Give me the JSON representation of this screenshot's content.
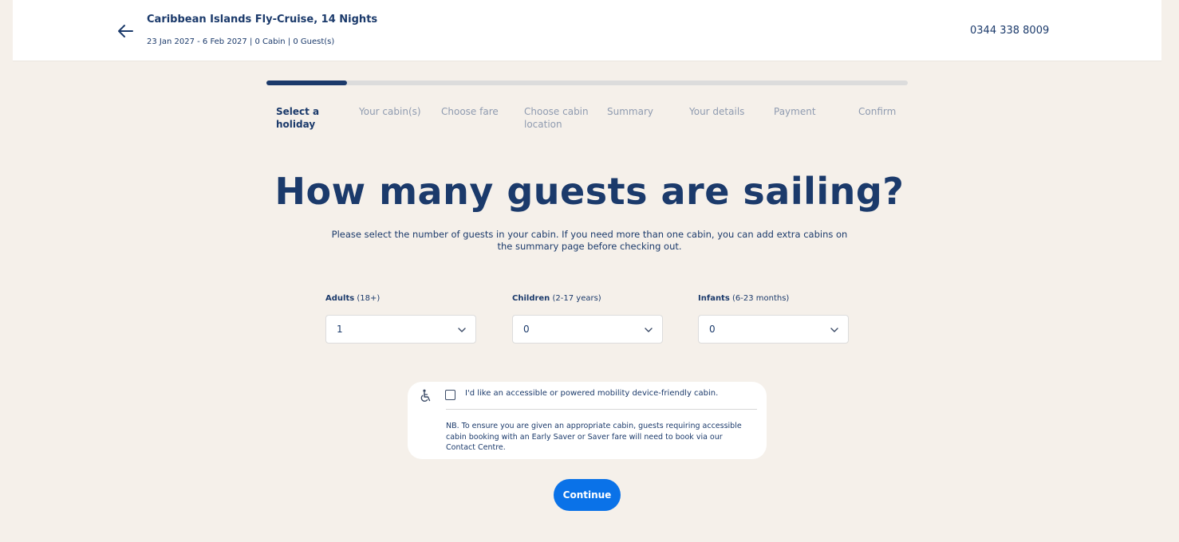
{
  "header": {
    "trip_title": "Caribbean Islands Fly-Cruise, 14 Nights",
    "trip_meta": "23 Jan 2027 - 6 Feb 2027  | 0 Cabin | 0 Guest(s)",
    "phone": "0344 338 8009"
  },
  "progress": {
    "fraction_complete": 0.125,
    "steps": [
      {
        "label": "Select a holiday",
        "active": true
      },
      {
        "label": "Your cabin(s)",
        "active": false
      },
      {
        "label": "Choose fare",
        "active": false
      },
      {
        "label": "Choose cabin location",
        "active": false
      },
      {
        "label": "Summary",
        "active": false
      },
      {
        "label": "Your details",
        "active": false
      },
      {
        "label": "Payment",
        "active": false
      },
      {
        "label": "Confirm",
        "active": false
      }
    ]
  },
  "main": {
    "headline": "How many guests are sailing?",
    "subtext": "Please select the number of guests in your cabin. If you need more than one cabin, you can add extra cabins on the summary page before checking out."
  },
  "guests": {
    "adults": {
      "label": "Adults",
      "range": "(18+)",
      "value": "1"
    },
    "children": {
      "label": "Children",
      "range": "(2-17 years)",
      "value": "0"
    },
    "infants": {
      "label": "Infants",
      "range": "(6-23 months)",
      "value": "0"
    }
  },
  "accessibility": {
    "checkbox_label": "I'd like an accessible or powered mobility device-friendly cabin.",
    "checked": false,
    "note": "NB. To ensure you are given an appropriate cabin, guests requiring accessible cabin booking with an Early Saver or Saver fare will need to book via our Contact Centre."
  },
  "actions": {
    "continue_label": "Continue"
  },
  "colors": {
    "background": "#f5f0ea",
    "primary_text": "#1b3a6b",
    "muted_text": "#8f9bb0",
    "accent_button": "#0a72e8"
  },
  "icons": {
    "back": "arrow-left-icon",
    "dropdown": "chevron-down-icon",
    "accessibility": "wheelchair-icon"
  }
}
